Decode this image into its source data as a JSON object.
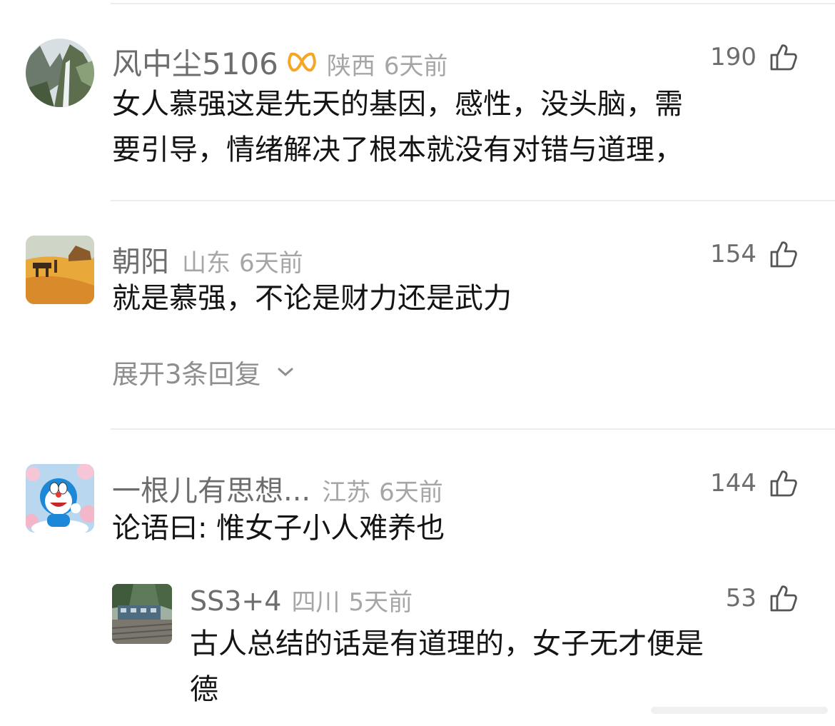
{
  "comments": [
    {
      "username": "风中尘5106",
      "location": "陕西",
      "time": "6天前",
      "likes": "190",
      "text_lines": [
        "女人慕强这是先天的基因，感性，没头脑，需",
        "要引导，情绪解决了根本就没有对错与道理，"
      ],
      "avatar": "waterfall-cliff-avatar"
    },
    {
      "username": "朝阳",
      "location": "山东",
      "time": "6天前",
      "likes": "154",
      "text_lines": [
        "就是慕强，不论是财力还是武力"
      ],
      "expand_label": "展开3条回复",
      "avatar": "painting-avatar"
    },
    {
      "username": "一根儿有思想...",
      "location": "江苏",
      "time": "6天前",
      "likes": "144",
      "text_lines": [
        "论语曰: 惟女子小人难养也"
      ],
      "avatar": "doraemon-avatar"
    }
  ],
  "reply": {
    "username": "SS3+4",
    "location": "四川",
    "time": "5天前",
    "likes": "53",
    "text_lines": [
      "古人总结的话是有道理的，女子无才便是",
      "德"
    ],
    "avatar": "train-avatar"
  },
  "icons": {
    "like": "thumbs-up-icon",
    "vip_badge": "vip-badge-icon",
    "expand_arrow": "chevron-down-icon"
  },
  "colors": {
    "username": "#6d6d6d",
    "meta": "#a6a6a6",
    "text": "#141414",
    "vip": "#f5a623",
    "divider": "#ececec"
  }
}
